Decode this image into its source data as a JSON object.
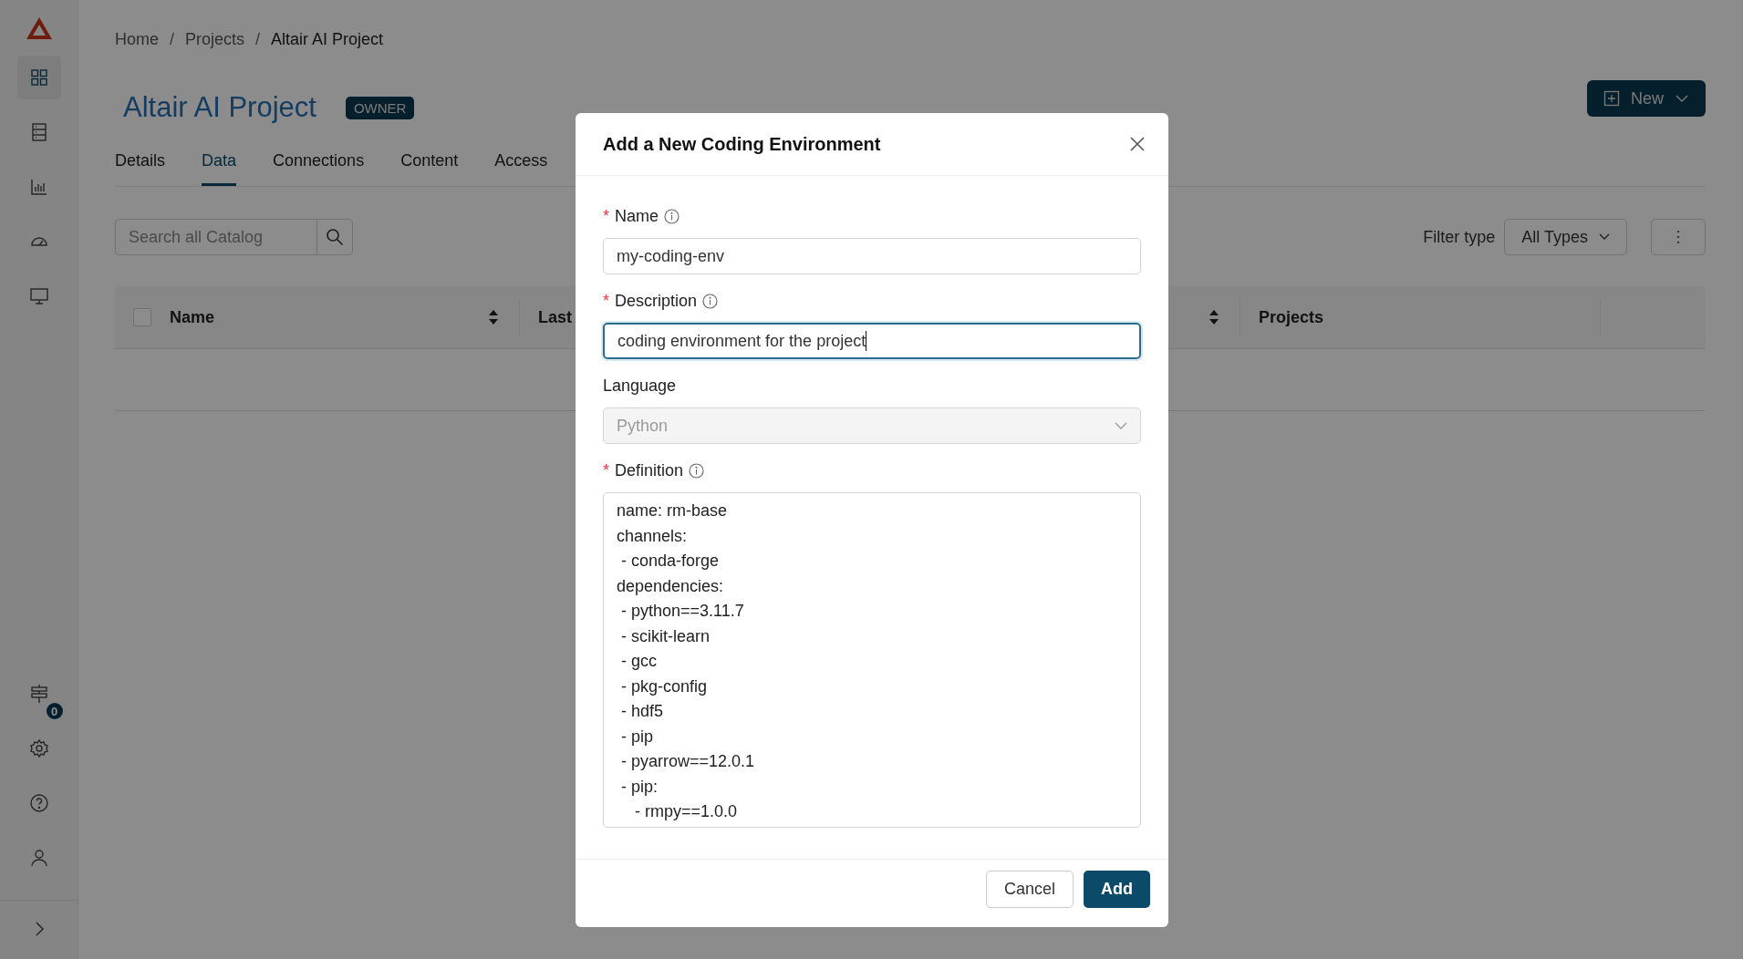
{
  "sidebar": {
    "items": [
      {
        "kind": "grid",
        "selected": true
      },
      {
        "kind": "server",
        "selected": false
      },
      {
        "kind": "chart",
        "selected": false
      },
      {
        "kind": "gauge",
        "selected": false
      },
      {
        "kind": "monitor",
        "selected": false
      }
    ],
    "bottom_items": [
      {
        "kind": "signpost",
        "badge": "0"
      },
      {
        "kind": "gear"
      },
      {
        "kind": "help"
      },
      {
        "kind": "user"
      }
    ]
  },
  "breadcrumb": [
    {
      "kind": "link",
      "text": "Home"
    },
    {
      "kind": "separator",
      "text": "/"
    },
    {
      "kind": "link",
      "text": "Projects"
    },
    {
      "kind": "separator",
      "text": "/"
    },
    {
      "kind": "current",
      "text": "Altair AI Project"
    }
  ],
  "project": {
    "title": "Altair AI Project",
    "role": "OWNER"
  },
  "new_button": {
    "label": "New"
  },
  "tabs": [
    {
      "label": "Details",
      "selected": false
    },
    {
      "label": "Data",
      "selected": true
    },
    {
      "label": "Connections",
      "selected": false
    },
    {
      "label": "Content",
      "selected": false
    },
    {
      "label": "Access",
      "selected": false
    }
  ],
  "search": {
    "placeholder": "Search all Catalog"
  },
  "filter": {
    "label": "Filter type",
    "value": "All Types"
  },
  "table": {
    "select_all": {
      "checked": false
    },
    "columns": [
      {
        "label": "Name",
        "sortable": true
      },
      {
        "label": "Last",
        "sortable": true
      },
      {
        "label": "Projects",
        "sortable": false
      }
    ]
  },
  "dialog": {
    "title": "Add a New Coding Environment",
    "fields": [
      {
        "kind": "input",
        "required_mark": "*",
        "label": "Name",
        "info": true,
        "value": "my-coding-env",
        "focused": false
      },
      {
        "kind": "input",
        "required_mark": "*",
        "label": "Description",
        "info": true,
        "value": "coding environment for the project",
        "focused": true
      },
      {
        "kind": "select",
        "label": "Language",
        "info": false,
        "value": "Python",
        "disabled": true
      },
      {
        "kind": "textarea",
        "required_mark": "*",
        "label": "Definition",
        "info": true,
        "lines": [
          "name: rm-base",
          "channels:",
          " - conda-forge",
          "dependencies:",
          " - python==3.11.7",
          " - scikit-learn",
          " - gcc",
          " - pkg-config",
          " - hdf5",
          " - pip",
          " - pyarrow==12.0.1",
          " - pip:",
          "    - rmpy==1.0.0"
        ]
      }
    ],
    "buttons": [
      {
        "label": "Cancel",
        "kind": "secondary"
      },
      {
        "label": "Add",
        "kind": "primary"
      }
    ]
  }
}
